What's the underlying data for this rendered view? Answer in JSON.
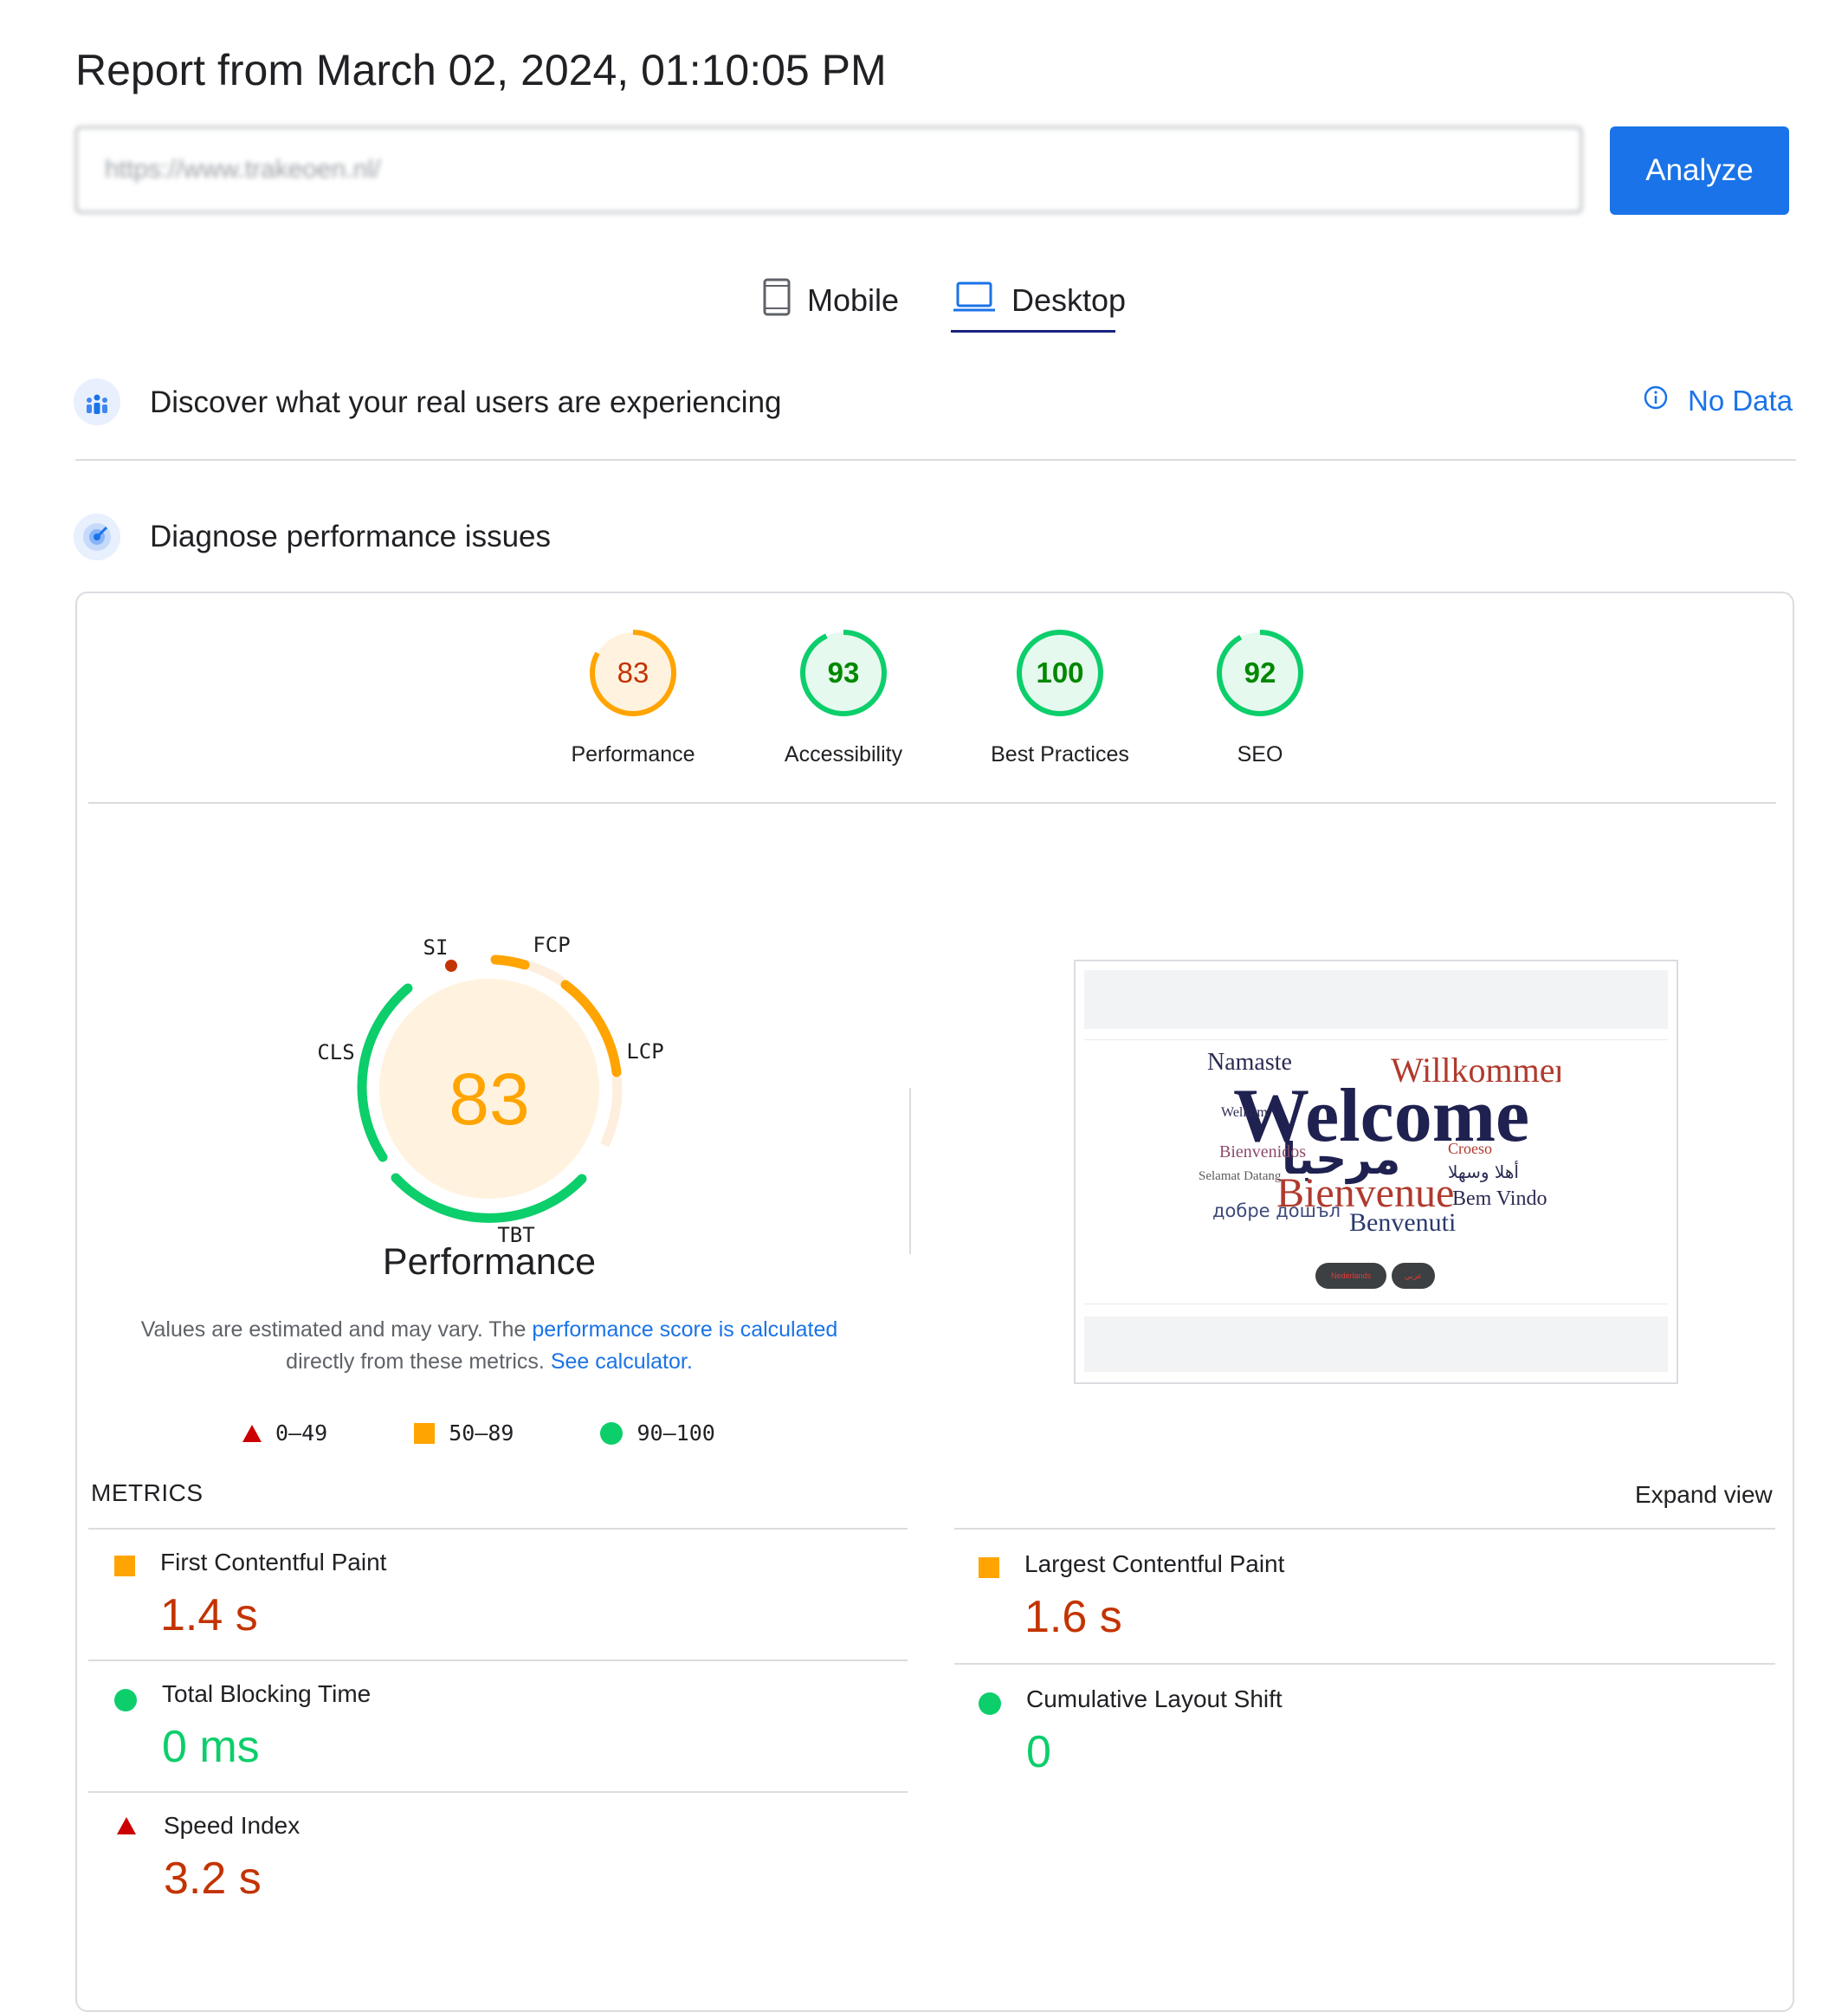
{
  "header": {
    "title": "Report from March 02, 2024, 01:10:05 PM",
    "url_value": "https://www.trakeoen.nl/",
    "analyze_label": "Analyze"
  },
  "tabs": [
    {
      "label": "Mobile",
      "icon": "mobile-phone-icon",
      "selected": false
    },
    {
      "label": "Desktop",
      "icon": "laptop-icon",
      "selected": true
    }
  ],
  "field_data": {
    "title": "Discover what your real users are experiencing",
    "status": "No Data",
    "status_icon": "info-icon"
  },
  "diagnose": {
    "title": "Diagnose performance issues"
  },
  "scores": [
    {
      "label": "Performance",
      "value": "83",
      "fraction": 0.83,
      "rating": "average"
    },
    {
      "label": "Accessibility",
      "value": "93",
      "fraction": 0.93,
      "rating": "pass"
    },
    {
      "label": "Best Practices",
      "value": "100",
      "fraction": 1.0,
      "rating": "pass"
    },
    {
      "label": "SEO",
      "value": "92",
      "fraction": 0.92,
      "rating": "pass"
    }
  ],
  "performance_gauge": {
    "score": "83",
    "label": "Performance",
    "segments": {
      "SI": "SI",
      "FCP": "FCP",
      "LCP": "LCP",
      "TBT": "TBT",
      "CLS": "CLS"
    }
  },
  "note": {
    "text_1": "Values are estimated and may vary. The ",
    "link_1": "performance score is calculated",
    "text_2": " directly from these metrics. ",
    "link_2": "See calculator."
  },
  "legend": [
    {
      "range": "0–49",
      "shape": "triangle",
      "color": "#cc0000"
    },
    {
      "range": "50–89",
      "shape": "square",
      "color": "#ffa400"
    },
    {
      "range": "90–100",
      "shape": "circle",
      "color": "#0cce6b"
    }
  ],
  "metrics_heading": "METRICS",
  "expand_view": "Expand view",
  "metrics": {
    "fcp": {
      "name": "First Contentful Paint",
      "value": "1.4 s",
      "rating": "average"
    },
    "lcp": {
      "name": "Largest Contentful Paint",
      "value": "1.6 s",
      "rating": "average"
    },
    "tbt": {
      "name": "Total Blocking Time",
      "value": "0 ms",
      "rating": "pass"
    },
    "cls": {
      "name": "Cumulative Layout Shift",
      "value": "0",
      "rating": "pass"
    },
    "si": {
      "name": "Speed Index",
      "value": "3.2 s",
      "rating": "fail"
    }
  },
  "screenshot": {
    "words": [
      "Namaste",
      "Willkommen",
      "Welcome",
      "مرحبا",
      "Bienvenue",
      "Bem Vindo",
      "Benvenuti",
      "Bienvenidos",
      "Selamat Datang",
      "Welkom",
      "Croeso",
      "أهلا وسهلا",
      "добре дошъл"
    ],
    "buttons": [
      "Nederlands",
      "عربي"
    ]
  },
  "colors": {
    "accent": "#1a73e8",
    "average": "#ffa400",
    "pass": "#0cce6b",
    "fail": "#cc0000",
    "average_text": "#c33300",
    "pass_text": "#008800"
  }
}
